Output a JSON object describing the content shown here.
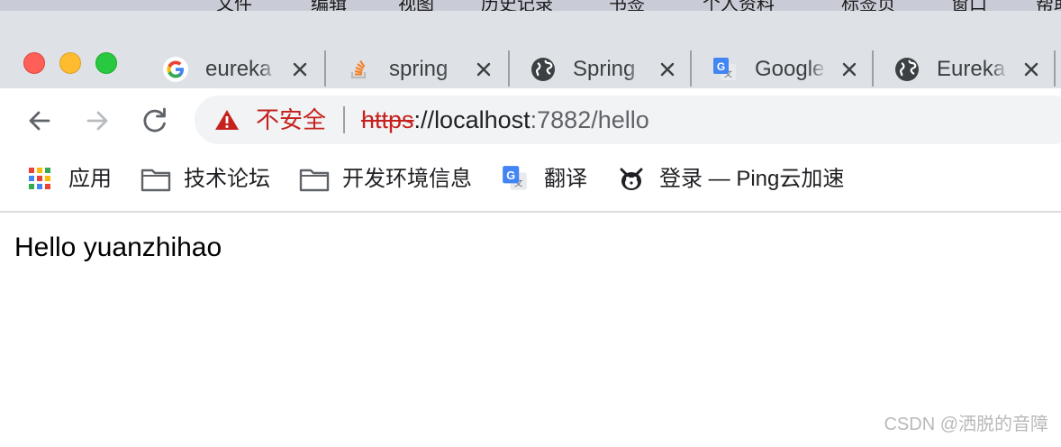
{
  "menubar": {
    "items": [
      "文件",
      "编辑",
      "视图",
      "历史记录",
      "书签",
      "个人资料",
      "标签页",
      "窗口",
      "帮助"
    ]
  },
  "window_controls": {
    "close": "close",
    "minimize": "minimize",
    "maximize": "maximize"
  },
  "tabs": [
    {
      "title": "eureka",
      "icon": "google-icon"
    },
    {
      "title": "spring",
      "icon": "stackoverflow-icon"
    },
    {
      "title": "Spring",
      "icon": "globe-icon"
    },
    {
      "title": "Google",
      "icon": "google-translate-icon"
    },
    {
      "title": "Eureka",
      "icon": "globe-icon"
    }
  ],
  "toolbar": {
    "security_label": "不安全",
    "url_scheme": "https",
    "url_sep": "://",
    "url_host": "localhost",
    "url_rest": ":7882/hello"
  },
  "bookmarks": [
    {
      "label": "应用",
      "icon": "apps-grid-icon"
    },
    {
      "label": "技术论坛",
      "icon": "folder-icon"
    },
    {
      "label": "开发环境信息",
      "icon": "folder-icon"
    },
    {
      "label": "翻译",
      "icon": "google-translate-icon"
    },
    {
      "label": "登录 — Ping云加速",
      "icon": "ping-logo-icon"
    }
  ],
  "page": {
    "body_text": "Hello yuanzhihao"
  },
  "watermark": "CSDN @洒脱的音障",
  "colors": {
    "tabstrip_bg": "#dee1e6",
    "insecure_red": "#c5221f",
    "omnibox_bg": "#f1f3f4"
  }
}
